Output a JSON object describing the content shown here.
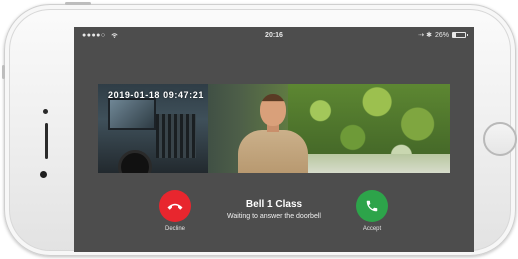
{
  "status_bar": {
    "signal": "●●●●○",
    "time": "20:16",
    "location_bluetooth": "⇢ ✱",
    "battery_text": "26%",
    "battery_level": 0.26
  },
  "video": {
    "timestamp": "2019-01-18 09:47:21"
  },
  "call": {
    "title": "Bell 1 Class",
    "status": "Waiting to answer the doorbell",
    "decline_label": "Decline",
    "accept_label": "Accept"
  },
  "colors": {
    "decline": "#e8262e",
    "accept": "#2da44a"
  }
}
